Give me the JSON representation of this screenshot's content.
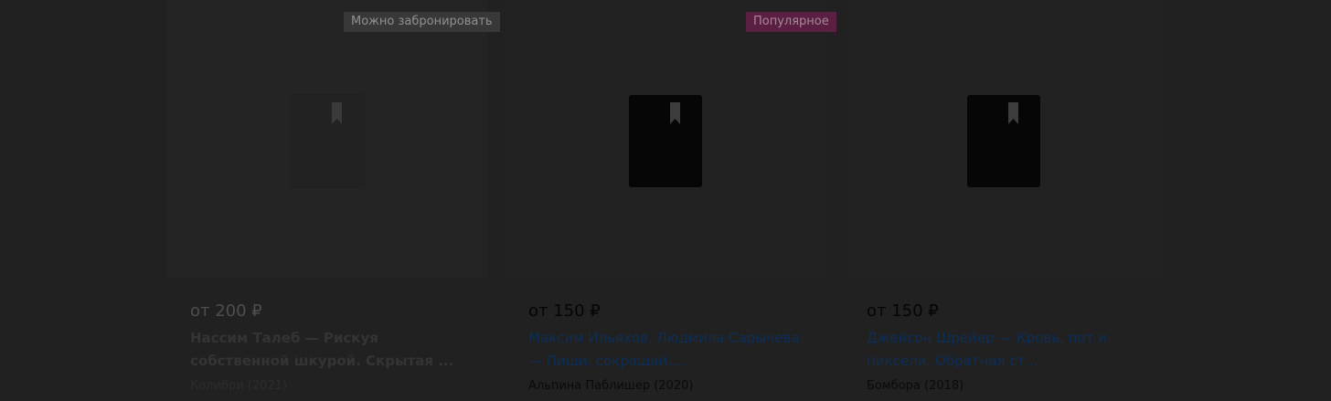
{
  "products": [
    {
      "badge": "Можно забронировать",
      "price": "от 200 ₽",
      "title": "Нассим Талеб — Рискуя собственной шкурой. Скрытая ...",
      "publisher": "Колибри (2021)"
    },
    {
      "badge": "Популярное",
      "price": "от 150 ₽",
      "title": "Максим Ильяхов, Людмила Сарычева — Пиши, сокращай....",
      "publisher": "Альпина Паблишер (2020)"
    },
    {
      "badge": "",
      "price": "от 150 ₽",
      "title": "Джейсон Шрейер — Кровь, пот и пиксели. Обратная ст...",
      "publisher": "Бомбора (2018)"
    }
  ],
  "colors": {
    "overlay_background": "#212121",
    "badge_popular": "#5c1f44",
    "title_link": "#0d2e56"
  },
  "icons": {
    "cover_placeholder": "book-placeholder-icon"
  }
}
